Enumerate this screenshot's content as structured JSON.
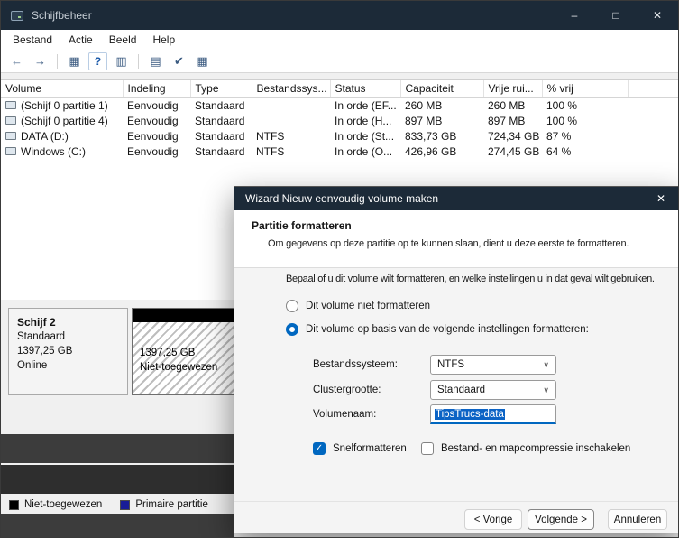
{
  "window": {
    "title": "Schijfbeheer",
    "menu": [
      "Bestand",
      "Actie",
      "Beeld",
      "Help"
    ],
    "controls": {
      "minimize": "–",
      "maximize": "□",
      "close": "✕"
    },
    "titlebar_color": "#1c2a38"
  },
  "toolbar": {
    "icons": [
      {
        "name": "back-icon",
        "glyph": "←"
      },
      {
        "name": "forward-icon",
        "glyph": "→"
      },
      {
        "name": "console-window-icon",
        "glyph": "▦"
      },
      {
        "name": "help-icon",
        "glyph": "?"
      },
      {
        "name": "properties-table-icon",
        "glyph": "▥"
      },
      {
        "name": "action-pane-icon",
        "glyph": "▤"
      },
      {
        "name": "check-icon",
        "glyph": "✔"
      },
      {
        "name": "disk-list-icon",
        "glyph": "▦"
      }
    ]
  },
  "table": {
    "columns": [
      "Volume",
      "Indeling",
      "Type",
      "Bestandssys...",
      "Status",
      "Capaciteit",
      "Vrije rui...",
      "% vrij"
    ],
    "rows": [
      [
        "(Schijf 0 partitie 1)",
        "Eenvoudig",
        "Standaard",
        "",
        "In orde (EF...",
        "260 MB",
        "260 MB",
        "100 %"
      ],
      [
        "(Schijf 0 partitie 4)",
        "Eenvoudig",
        "Standaard",
        "",
        "In orde (H...",
        "897 MB",
        "897 MB",
        "100 %"
      ],
      [
        "DATA (D:)",
        "Eenvoudig",
        "Standaard",
        "NTFS",
        "In orde (St...",
        "833,73 GB",
        "724,34 GB",
        "87 %"
      ],
      [
        "Windows (C:)",
        "Eenvoudig",
        "Standaard",
        "NTFS",
        "In orde (O...",
        "426,96 GB",
        "274,45 GB",
        "64 %"
      ]
    ]
  },
  "disk": {
    "name": "Schijf 2",
    "layout": "Standaard",
    "size": "1397,25 GB",
    "status": "Online",
    "unalloc_size": "1397,25 GB",
    "unalloc_label": "Niet-toegewezen",
    "unalloc_band_color": "#000000"
  },
  "legend": {
    "items": [
      {
        "label": "Niet-toegewezen",
        "color": "#000000"
      },
      {
        "label": "Primaire partitie",
        "color": "#181c96"
      }
    ]
  },
  "dialog": {
    "title": "Wizard Nieuw eenvoudig volume maken",
    "close": "✕",
    "heading": "Partitie formatteren",
    "description": "Om gegevens op deze partitie op te kunnen slaan, dient u deze eerste te formatteren.",
    "intro": "Bepaal of u dit volume wilt formatteren, en welke instellingen u in dat geval wilt gebruiken.",
    "radio_no_format": "Dit volume niet formatteren",
    "radio_format": "Dit volume op basis van de volgende instellingen formatteren:",
    "fields": {
      "filesystem_label": "Bestandssysteem:",
      "filesystem_value": "NTFS",
      "cluster_label": "Clustergrootte:",
      "cluster_value": "Standaard",
      "volume_label": "Volumenaam:",
      "volume_value": "TipsTrucs-data"
    },
    "check_glyph": "✓",
    "chevron_glyph": "∨",
    "quick_format": "Snelformatteren",
    "compression": "Bestand- en mapcompressie inschakelen",
    "buttons": {
      "back": "< Vorige",
      "next": "Volgende >",
      "cancel": "Annuleren"
    },
    "accent": "#0067c0"
  }
}
